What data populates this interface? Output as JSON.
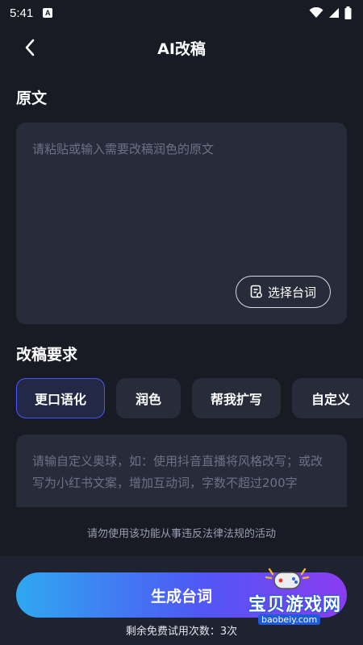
{
  "status_bar": {
    "time": "5:41",
    "badge": "A"
  },
  "header": {
    "title": "AI改稿"
  },
  "source": {
    "section_label": "原文",
    "placeholder": "请粘贴或输入需要改稿润色的原文",
    "select_button_label": "选择台词"
  },
  "requirements": {
    "section_label": "改稿要求",
    "chips": [
      {
        "label": "更口语化",
        "active": true
      },
      {
        "label": "润色",
        "active": false
      },
      {
        "label": "帮我扩写",
        "active": false
      },
      {
        "label": "自定义",
        "active": false
      }
    ],
    "placeholder": "请输自定义奥球，如：使用抖音直播将风格改写；或改写为小红书文案，增加互动词，字数不超过200字"
  },
  "notice": "请勿使用该功能从事违反法律法规的活动",
  "generate_button_label": "生成台词",
  "free_trials_text": "剩余免费试用次数：3次",
  "watermark": {
    "text": "宝贝游戏网",
    "url": "baobeiy.com"
  },
  "colors": {
    "background": "#181a24",
    "card": "#272b3a",
    "accent": "#4b55ff",
    "placeholder": "#6c7186"
  }
}
